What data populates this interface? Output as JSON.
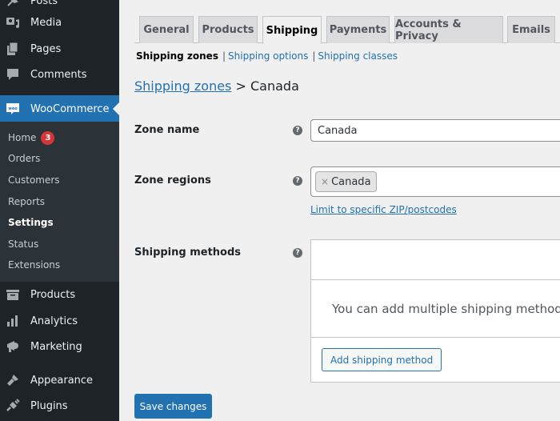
{
  "sidebar": {
    "top_items": [
      {
        "label": "Posts",
        "icon": "pin-icon"
      },
      {
        "label": "Media",
        "icon": "media-icon"
      },
      {
        "label": "Pages",
        "icon": "pages-icon"
      },
      {
        "label": "Comments",
        "icon": "comments-icon"
      }
    ],
    "woocommerce": {
      "label": "WooCommerce",
      "icon": "woo-icon",
      "icon_text": "woo"
    },
    "submenu": [
      {
        "label": "Home",
        "badge": "3"
      },
      {
        "label": "Orders"
      },
      {
        "label": "Customers"
      },
      {
        "label": "Reports"
      },
      {
        "label": "Settings",
        "current": true
      },
      {
        "label": "Status"
      },
      {
        "label": "Extensions"
      }
    ],
    "bottom_items": [
      {
        "label": "Products",
        "icon": "archive-icon"
      },
      {
        "label": "Analytics",
        "icon": "bar-chart-icon"
      },
      {
        "label": "Marketing",
        "icon": "megaphone-icon"
      },
      {
        "label": "Appearance",
        "icon": "paintbrush-icon"
      },
      {
        "label": "Plugins",
        "icon": "plug-icon"
      }
    ]
  },
  "tabs": [
    {
      "label": "General"
    },
    {
      "label": "Products"
    },
    {
      "label": "Shipping",
      "active": true
    },
    {
      "label": "Payments"
    },
    {
      "label": "Accounts & Privacy"
    },
    {
      "label": "Emails"
    }
  ],
  "subnav": {
    "current": "Shipping zones",
    "separator": "|",
    "links": [
      "Shipping options",
      "Shipping classes"
    ]
  },
  "heading": {
    "crumb": "Shipping zones",
    "separator": ">",
    "title": "Canada"
  },
  "form": {
    "zone_name": {
      "label": "Zone name",
      "value": "Canada",
      "help": "?"
    },
    "zone_regions": {
      "label": "Zone regions",
      "chips": [
        "Canada"
      ],
      "chip_remove": "×",
      "help": "?",
      "limit_link": "Limit to specific ZIP/postcodes"
    },
    "shipping_methods": {
      "label": "Shipping methods",
      "help": "?",
      "empty_text": "You can add multiple shipping methods within this zone. Only customers within the zone will see them.",
      "add_button": "Add shipping method"
    }
  },
  "save_button": "Save changes",
  "colors": {
    "accent": "#2271b1",
    "sidebar": "#1d2327",
    "submenu": "#2c3338",
    "badge": "#d63638"
  }
}
